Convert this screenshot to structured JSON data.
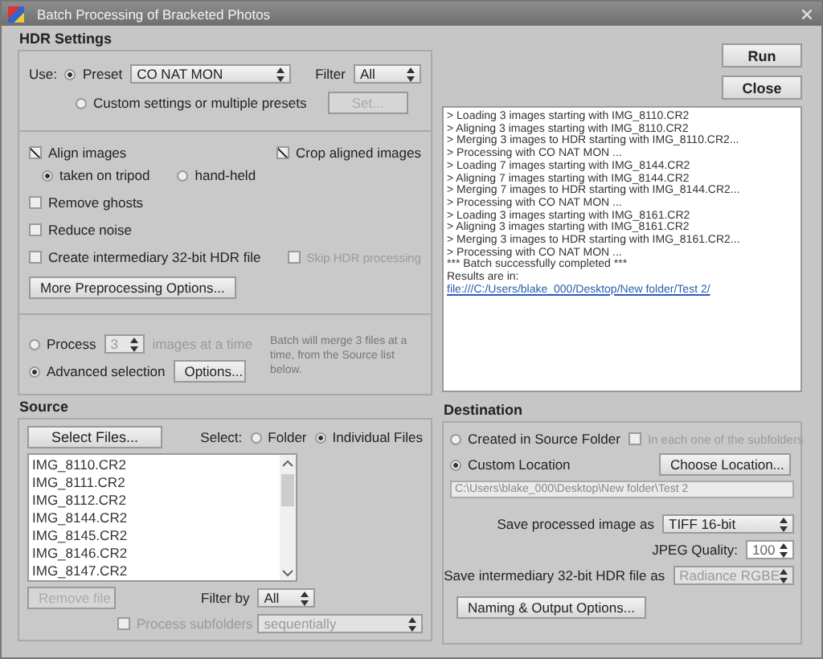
{
  "window": {
    "title": "Batch Processing of Bracketed Photos"
  },
  "hdr_settings": {
    "heading": "HDR Settings",
    "use_label": "Use:",
    "use_options": [
      {
        "label": "Preset",
        "selected": true
      },
      {
        "label": "Custom settings or multiple presets",
        "selected": false
      }
    ],
    "preset_select": "CO NAT MON",
    "filter_label": "Filter",
    "filter_select": "All",
    "set_button": {
      "label": "Set...",
      "disabled": true
    },
    "align_images": {
      "label": "Align images",
      "checked": true
    },
    "align_modes": [
      {
        "label": "taken on tripod",
        "selected": true
      },
      {
        "label": "hand-held",
        "selected": false
      }
    ],
    "crop_aligned": {
      "label": "Crop aligned images",
      "checked": true
    },
    "checkboxes": [
      {
        "label": "Remove ghosts",
        "checked": false
      },
      {
        "label": "Reduce noise",
        "checked": false
      },
      {
        "label": "Create intermediary 32-bit HDR file",
        "checked": false
      }
    ],
    "skip_hdr": {
      "label": "Skip HDR processing",
      "checked": false,
      "disabled": true
    },
    "more_button": "More Preprocessing Options...",
    "selection_modes": [
      {
        "label": "Process",
        "selected": false
      },
      {
        "label": "Advanced selection",
        "selected": true
      }
    ],
    "process_count": "3",
    "process_suffix": "images at a time",
    "options_button": "Options...",
    "batch_note": "Batch will merge 3 files at a time, from the Source list below."
  },
  "actions": [
    "Run",
    "Close"
  ],
  "log": {
    "lines": [
      "> Loading 3 images starting with IMG_8110.CR2",
      "> Aligning 3 images starting with IMG_8110.CR2",
      "> Merging 3 images to HDR starting with IMG_8110.CR2...",
      "> Processing with CO NAT MON ...",
      "> Loading 7 images starting with IMG_8144.CR2",
      "> Aligning 7 images starting with IMG_8144.CR2",
      "> Merging 7 images to HDR starting with IMG_8144.CR2...",
      "> Processing with CO NAT MON ...",
      "> Loading 3 images starting with IMG_8161.CR2",
      "> Aligning 3 images starting with IMG_8161.CR2",
      "> Merging 3 images to HDR starting with IMG_8161.CR2...",
      "> Processing with CO NAT MON ...",
      "*** Batch successfully completed ***",
      "Results are in:"
    ],
    "link": "file:///C:/Users/blake_000/Desktop/New folder/Test 2/"
  },
  "source": {
    "heading": "Source",
    "select_files_button": "Select Files...",
    "select_label": "Select:",
    "select_options": [
      {
        "label": "Folder",
        "selected": false
      },
      {
        "label": "Individual Files",
        "selected": true
      }
    ],
    "files": [
      "IMG_8110.CR2",
      "IMG_8111.CR2",
      "IMG_8112.CR2",
      "IMG_8144.CR2",
      "IMG_8145.CR2",
      "IMG_8146.CR2",
      "IMG_8147.CR2"
    ],
    "remove_button": {
      "label": "Remove file",
      "disabled": true
    },
    "filter_by_label": "Filter by",
    "filter_by": "All",
    "process_subfolders": {
      "label": "Process subfolders",
      "checked": false,
      "disabled": true
    },
    "subfolder_select": {
      "value": "sequentially",
      "disabled": true
    }
  },
  "destination": {
    "heading": "Destination",
    "options": [
      {
        "label": "Created in Source Folder",
        "selected": false
      },
      {
        "label": "Custom Location",
        "selected": true
      }
    ],
    "each_subfolder": {
      "label": "In each one of the subfolders",
      "checked": false,
      "disabled": true
    },
    "choose_button": "Choose Location...",
    "path": "C:\\Users\\blake_000\\Desktop\\New folder\\Test 2",
    "save_label": "Save processed image as",
    "save_select": {
      "value": "TIFF 16-bit",
      "disabled": false
    },
    "jpeg_label": "JPEG Quality:",
    "jpeg_quality": "100",
    "save32_label": "Save intermediary 32-bit HDR file as",
    "save32_select": {
      "value": "Radiance RGBE",
      "disabled": true
    },
    "naming_button": "Naming & Output Options..."
  }
}
